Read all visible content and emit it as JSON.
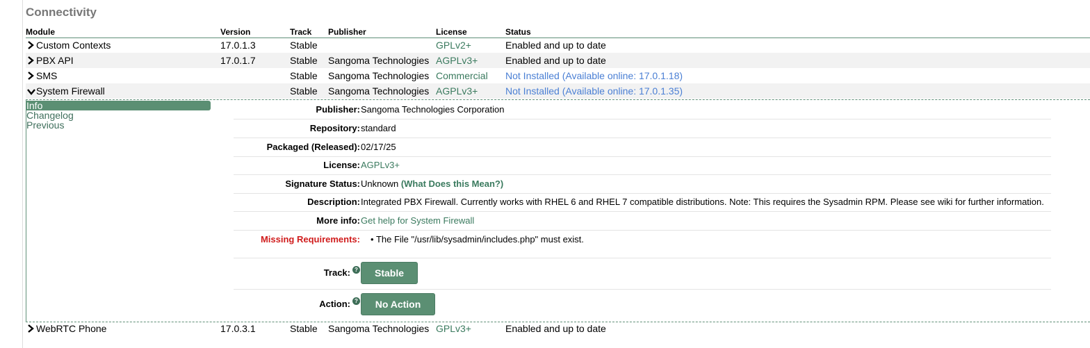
{
  "section": {
    "title": "Connectivity"
  },
  "columns": {
    "module": "Module",
    "version": "Version",
    "track": "Track",
    "publisher": "Publisher",
    "license": "License",
    "status": "Status"
  },
  "modules": [
    {
      "name": "Custom Contexts",
      "version": "17.0.1.3",
      "track": "Stable",
      "publisher": "",
      "license": "GPLv2+",
      "status": "Enabled and up to date"
    },
    {
      "name": "PBX API",
      "version": "17.0.1.7",
      "track": "Stable",
      "publisher": "Sangoma Technologies",
      "license": "AGPLv3+",
      "status": "Enabled and up to date"
    },
    {
      "name": "SMS",
      "version": "",
      "track": "Stable",
      "publisher": "Sangoma Technologies",
      "license": "Commercial",
      "status": "Not Installed (Available online: 17.0.1.18)"
    },
    {
      "name": "System Firewall",
      "version": "",
      "track": "Stable",
      "publisher": "Sangoma Technologies",
      "license": "AGPLv3+",
      "status": "Not Installed (Available online: 17.0.1.35)"
    },
    {
      "name": "WebRTC Phone",
      "version": "17.0.3.1",
      "track": "Stable",
      "publisher": "Sangoma Technologies",
      "license": "GPLv3+",
      "status": "Enabled and up to date"
    }
  ],
  "detail": {
    "tabs": [
      "Info",
      "Changelog",
      "Previous"
    ],
    "publisher_label": "Publisher:",
    "publisher": "Sangoma Technologies Corporation",
    "repository_label": "Repository:",
    "repository": "standard",
    "packaged_label": "Packaged (Released):",
    "packaged": "02/17/25",
    "license_label": "License:",
    "license": "AGPLv3+",
    "signature_label": "Signature Status:",
    "signature": "Unknown",
    "signature_link": "(What Does this Mean?)",
    "description_label": "Description:",
    "description": "Integrated PBX Firewall. Currently works with RHEL 6 and RHEL 7 compatible distributions. Note: This requires the Sysadmin RPM. Please see wiki for further information.",
    "moreinfo_label": "More info:",
    "moreinfo": "Get help for System Firewall",
    "missing_label": "Missing Requirements:",
    "missing_item": "The File \"/usr/lib/sysadmin/includes.php\" must exist.",
    "track_label": "Track:",
    "track_button": "Stable",
    "action_label": "Action:",
    "action_button": "No Action",
    "help_glyph": "?"
  },
  "colors": {
    "accent_green": "#5b8f73",
    "link_green": "#3a7a5e",
    "link_blue": "#4a7fd4",
    "error_red": "#d01c1c"
  },
  "icons": {
    "collapsed": "chevron-right-icon",
    "expanded": "chevron-down-icon",
    "help": "question-circle-icon"
  }
}
